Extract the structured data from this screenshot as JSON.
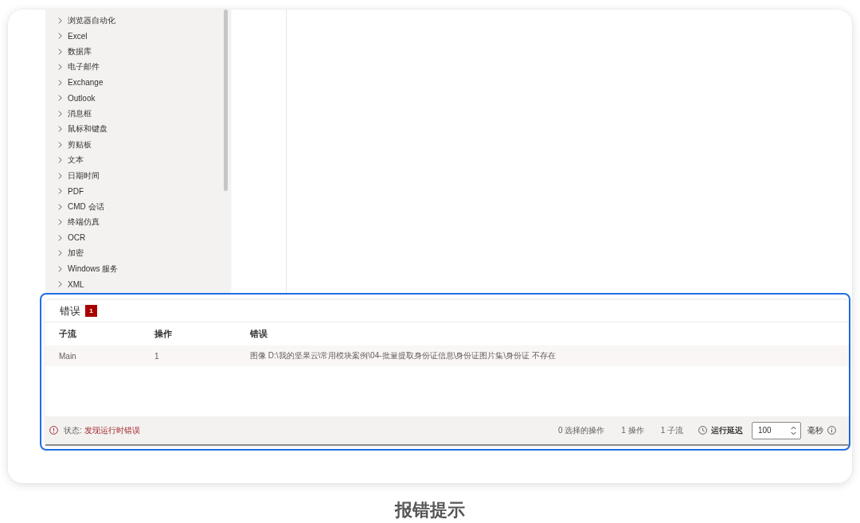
{
  "sidebar": {
    "items": [
      {
        "label": "浏览器自动化",
        "expanded": false
      },
      {
        "label": "Excel",
        "expanded": false
      },
      {
        "label": "数据库",
        "expanded": false
      },
      {
        "label": "电子邮件",
        "expanded": false
      },
      {
        "label": "Exchange",
        "expanded": false
      },
      {
        "label": "Outlook",
        "expanded": false
      },
      {
        "label": "消息框",
        "expanded": false
      },
      {
        "label": "鼠标和键盘",
        "expanded": false
      },
      {
        "label": "剪贴板",
        "expanded": false
      },
      {
        "label": "文本",
        "expanded": false
      },
      {
        "label": "日期时间",
        "expanded": false
      },
      {
        "label": "PDF",
        "expanded": false
      },
      {
        "label": "CMD 会话",
        "expanded": false
      },
      {
        "label": "终端仿真",
        "expanded": false
      },
      {
        "label": "OCR",
        "expanded": false
      },
      {
        "label": "加密",
        "expanded": false
      },
      {
        "label": "Windows 服务",
        "expanded": false
      },
      {
        "label": "XML",
        "expanded": false
      }
    ]
  },
  "error_panel": {
    "title": "错误",
    "count": "1",
    "columns": [
      "子流",
      "操作",
      "错误"
    ],
    "rows": [
      {
        "cells": [
          "Main",
          "1",
          "图像 D:\\我的坚果云\\常用模块案例\\04-批量提取身份证信息\\身份证图片集\\身份证 不存在"
        ]
      }
    ]
  },
  "status_bar": {
    "status": {
      "kind": "error",
      "label": "状态:",
      "message": "发现运行时错误"
    },
    "counts": [
      "0 选择的操作",
      "1 操作",
      "1 子流"
    ],
    "run_delay": {
      "label": "运行延迟",
      "value": "100",
      "unit": "毫秒"
    }
  },
  "caption": "报错提示"
}
